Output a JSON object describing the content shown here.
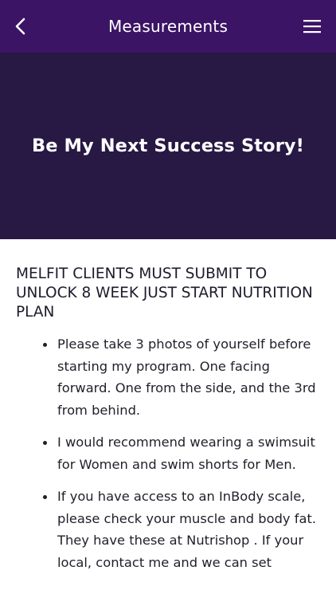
{
  "header": {
    "title": "Measurements",
    "back_icon": "chevron-left-icon",
    "menu_icon": "hamburger-menu-icon",
    "background": "#3b1466"
  },
  "hero": {
    "title": "Be My Next Success Story!",
    "background": "#271844"
  },
  "content": {
    "heading": "MELFIT CLIENTS MUST SUBMIT TO UNLOCK 8 WEEK JUST START NUTRITION PLAN",
    "bullets": [
      "Please take 3 photos of yourself before starting my program. One facing forward. One from the side, and the 3rd  from behind.",
      "I would recommend wearing a swimsuit for Women and swim shorts for Men.",
      "If you have access to an InBody scale, please check your muscle and body fat.  They have these at  Nutrishop .  If your local, contact me and we can set"
    ]
  }
}
